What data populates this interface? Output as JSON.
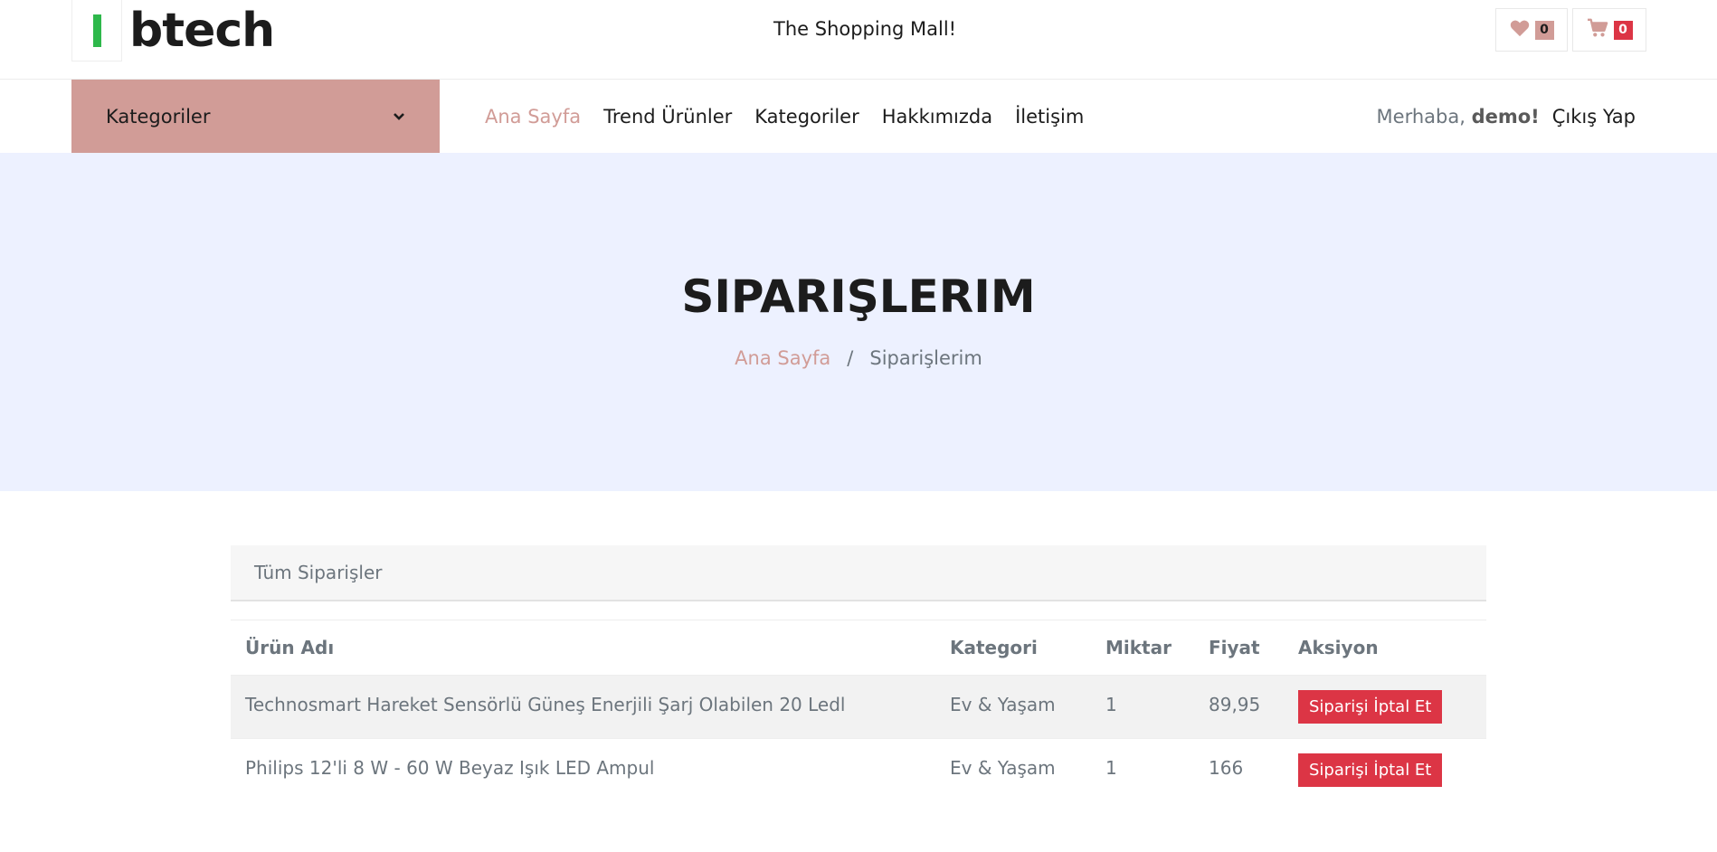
{
  "header": {
    "logo_text": "btech",
    "tagline": "The Shopping Mall!",
    "wishlist_count": "0",
    "cart_count": "0"
  },
  "nav": {
    "categories_label": "Kategoriler",
    "links": [
      "Ana Sayfa",
      "Trend Ürünler",
      "Kategoriler",
      "Hakkımızda",
      "İletişim"
    ],
    "greeting": "Merhaba,",
    "username": "demo!",
    "logout_label": "Çıkış Yap"
  },
  "hero": {
    "title": "SIPARIŞLERIM",
    "breadcrumb_home": "Ana Sayfa",
    "breadcrumb_sep": "/",
    "breadcrumb_current": "Siparişlerim"
  },
  "orders": {
    "panel_title": "Tüm Siparişler",
    "columns": [
      "Ürün Adı",
      "Kategori",
      "Miktar",
      "Fiyat",
      "Aksiyon"
    ],
    "rows": [
      {
        "name": "Technosmart Hareket Sensörlü Güneş Enerjili Şarj Olabilen 20 Ledl",
        "category": "Ev & Yaşam",
        "quantity": "1",
        "price": "89,95",
        "action": "Siparişi İptal Et"
      },
      {
        "name": "Philips 12'li 8 W - 60 W Beyaz Işık LED Ampul",
        "category": "Ev & Yaşam",
        "quantity": "1",
        "price": "166",
        "action": "Siparişi İptal Et"
      }
    ]
  },
  "colors": {
    "accent": "#d19c97",
    "hero_bg": "#edf1ff",
    "danger": "#dc3545",
    "logo_green": "#2eb84b"
  },
  "icons": {
    "wishlist": "heart-icon",
    "cart": "cart-icon",
    "categories_toggle": "chevron-down-icon"
  }
}
